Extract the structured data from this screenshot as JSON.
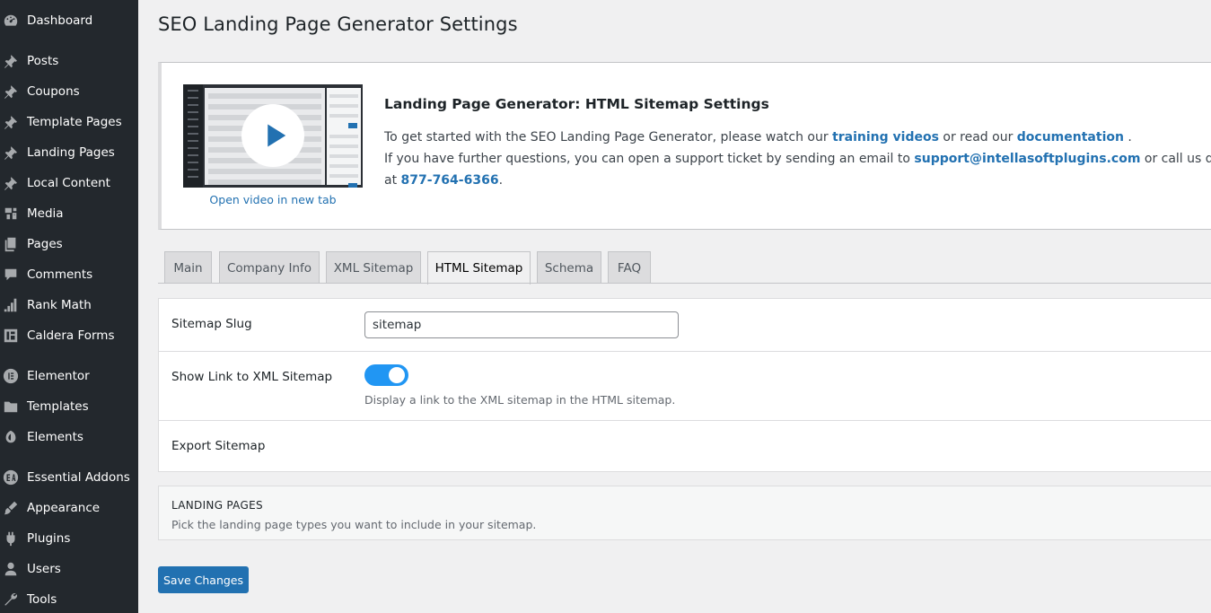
{
  "sidebar": {
    "items": [
      {
        "label": "Dashboard",
        "icon": "dashboard-icon"
      },
      {
        "label": "Posts",
        "icon": "pin-icon"
      },
      {
        "label": "Coupons",
        "icon": "pin-icon"
      },
      {
        "label": "Template Pages",
        "icon": "pin-icon"
      },
      {
        "label": "Landing Pages",
        "icon": "pin-icon"
      },
      {
        "label": "Local Content",
        "icon": "pin-icon"
      },
      {
        "label": "Media",
        "icon": "media-icon"
      },
      {
        "label": "Pages",
        "icon": "pages-icon"
      },
      {
        "label": "Comments",
        "icon": "comments-icon"
      },
      {
        "label": "Rank Math",
        "icon": "rank-math-icon"
      },
      {
        "label": "Caldera Forms",
        "icon": "caldera-forms-icon"
      },
      {
        "label": "Elementor",
        "icon": "elementor-icon"
      },
      {
        "label": "Templates",
        "icon": "folder-icon"
      },
      {
        "label": "Elements",
        "icon": "elements-icon"
      },
      {
        "label": "Essential Addons",
        "icon": "essential-addons-icon"
      },
      {
        "label": "Appearance",
        "icon": "appearance-icon"
      },
      {
        "label": "Plugins",
        "icon": "plugins-icon"
      },
      {
        "label": "Users",
        "icon": "users-icon"
      },
      {
        "label": "Tools",
        "icon": "tools-icon"
      }
    ]
  },
  "page": {
    "title": "SEO Landing Page Generator Settings"
  },
  "intro": {
    "video_link": "Open video in new tab",
    "title": "Landing Page Generator: HTML Sitemap Settings",
    "line1_pre": "To get started with the SEO Landing Page Generator, please watch our ",
    "line1_link1": "training videos",
    "line1_mid": " or read our ",
    "line1_link2": "documentation",
    "line1_post": " .",
    "line2_pre": "If you have further questions, you can open a support ticket by sending an email to ",
    "line2_email": "support@intellasoftplugins.com",
    "line2_post": " or call us directly",
    "line3_pre": "at ",
    "line3_phone": "877-764-6366",
    "line3_post": "."
  },
  "tabs": [
    {
      "label": "Main",
      "active": false
    },
    {
      "label": "Company Info",
      "active": false
    },
    {
      "label": "XML Sitemap",
      "active": false
    },
    {
      "label": "HTML Sitemap",
      "active": true
    },
    {
      "label": "Schema",
      "active": false
    },
    {
      "label": "FAQ",
      "active": false
    }
  ],
  "settings": {
    "sitemap_slug_label": "Sitemap Slug",
    "sitemap_slug_value": "sitemap",
    "show_link_label": "Show Link to XML Sitemap",
    "show_link_enabled": true,
    "show_link_desc": "Display a link to the XML sitemap in the HTML sitemap.",
    "export_label": "Export Sitemap"
  },
  "landing_pages": {
    "heading": "LANDING PAGES",
    "desc": "Pick the landing page types you want to include in your sitemap."
  },
  "save_label": "Save Changes",
  "colors": {
    "sidebar_bg": "#23282d",
    "accent": "#2271b1",
    "toggle_on": "#2196f3"
  }
}
